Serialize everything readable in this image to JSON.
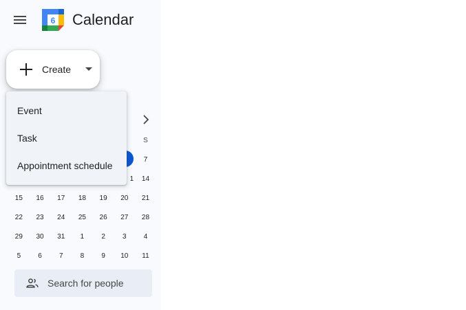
{
  "header": {
    "app_title": "Calendar",
    "logo_day": "6"
  },
  "create": {
    "label": "Create",
    "menu": [
      {
        "label": "Event"
      },
      {
        "label": "Task"
      },
      {
        "label": "Appointment schedule"
      }
    ]
  },
  "mini_calendar": {
    "visible_weekday_header": "S",
    "rows": [
      [
        "",
        "",
        "",
        "",
        "",
        "",
        "7"
      ],
      [
        "",
        "",
        "",
        "",
        "",
        "",
        "14"
      ],
      [
        "15",
        "16",
        "17",
        "18",
        "19",
        "20",
        "21"
      ],
      [
        "22",
        "23",
        "24",
        "25",
        "26",
        "27",
        "28"
      ],
      [
        "29",
        "30",
        "31",
        "1",
        "2",
        "3",
        "4"
      ],
      [
        "5",
        "6",
        "7",
        "8",
        "9",
        "10",
        "11"
      ]
    ],
    "partial_visible_cell": "1"
  },
  "search_people": {
    "placeholder": "Search for people"
  },
  "colors": {
    "accent": "#0b57d0",
    "sidebar_bg": "#f8fafd",
    "menu_bg": "#f0f4f9",
    "search_bg": "#e9eef6"
  }
}
